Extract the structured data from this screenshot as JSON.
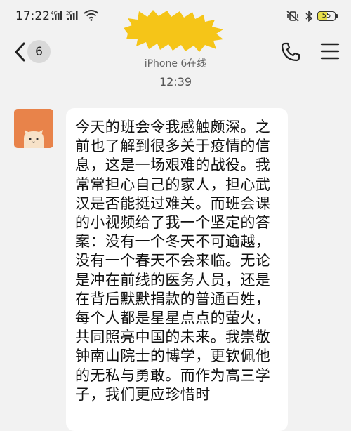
{
  "status_bar": {
    "time": "17:22",
    "signal_1_label": "4G",
    "signal_2_label": "2G",
    "battery_level": "55",
    "icons": [
      "signal-icon",
      "signal-icon",
      "wifi-icon",
      "vibrate-icon",
      "bluetooth-icon",
      "battery-icon"
    ]
  },
  "header": {
    "unread_count": "6",
    "contact_subtitle": "iPhone 6在线",
    "icons": [
      "back-arrow-icon",
      "phone-icon",
      "menu-icon"
    ]
  },
  "conversation": {
    "timestamp": "12:39",
    "messages": [
      {
        "sender": "incoming",
        "text": "今天的班会令我感触颇深。之前也了解到很多关于疫情的信息，这是一场艰难的战役。我常常担心自己的家人，担心武汉是否能挺过难关。而班会课的小视频给了我一个坚定的答案：没有一个冬天不可逾越，没有一个春天不会来临。无论是冲在前线的医务人员，还是在背后默默捐款的普通百姓，每个人都是星星点点的萤火，共同照亮中国的未来。我崇敬钟南山院士的博学，更钦佩他的无私与勇敢。而作为高三学子，我们更应珍惜时"
      }
    ]
  },
  "colors": {
    "background": "#f2f2f2",
    "bubble": "#ffffff",
    "redaction": "#f5c518",
    "avatar": "#e8834a"
  }
}
